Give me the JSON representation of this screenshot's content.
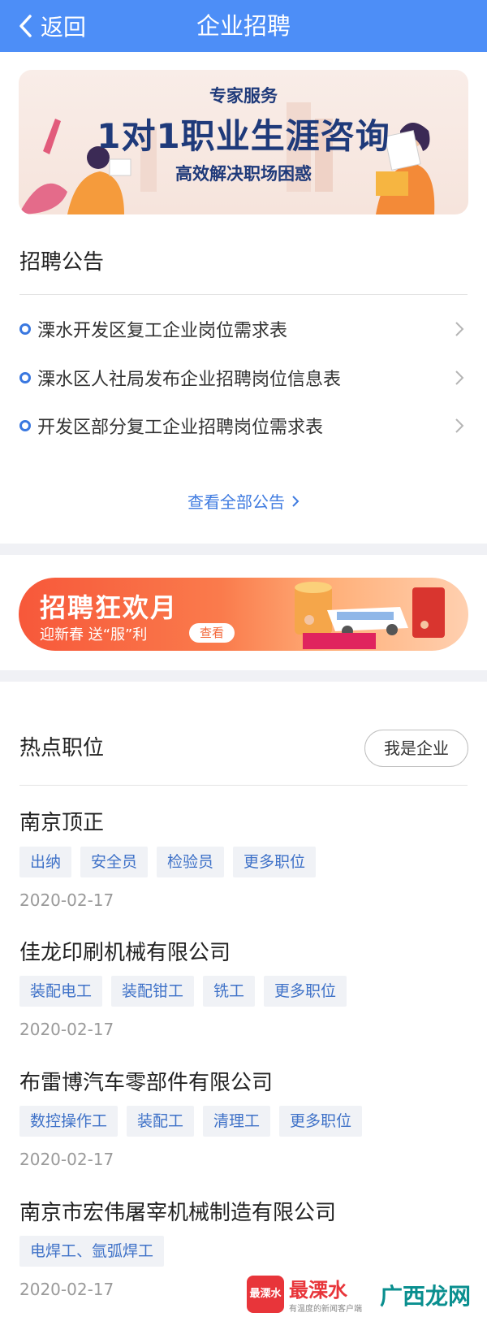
{
  "header": {
    "back_label": "返回",
    "title": "企业招聘"
  },
  "banner_career": {
    "subtitle": "专家服务",
    "headline": "1对1职业生涯咨询",
    "tagline": "高效解决职场困惑"
  },
  "notices": {
    "title": "招聘公告",
    "items": [
      {
        "label": "溧水开发区复工企业岗位需求表"
      },
      {
        "label": "溧水区人社局发布企业招聘岗位信息表"
      },
      {
        "label": "开发区部分复工企业招聘岗位需求表"
      }
    ],
    "view_all": "查看全部公告"
  },
  "banner_festival": {
    "title": "招聘狂欢月",
    "subtitle": "迎新春  送“服”利",
    "button": "查看"
  },
  "hot_jobs": {
    "title": "热点职位",
    "company_button": "我是企业",
    "companies": [
      {
        "name": "南京顶正",
        "tags": [
          "出纳",
          "安全员",
          "检验员",
          "更多职位"
        ],
        "date": "2020-02-17"
      },
      {
        "name": "佳龙印刷机械有限公司",
        "tags": [
          "装配电工",
          "装配钳工",
          "铣工",
          "更多职位"
        ],
        "date": "2020-02-17"
      },
      {
        "name": "布雷博汽车零部件有限公司",
        "tags": [
          "数控操作工",
          "装配工",
          "清理工",
          "更多职位"
        ],
        "date": "2020-02-17"
      },
      {
        "name": "南京市宏伟屠宰机械制造有限公司",
        "tags": [
          "电焊工、氩弧焊工"
        ],
        "date": "2020-02-17"
      }
    ]
  },
  "watermark": {
    "logo1": "最溧水",
    "text1": "最溧水",
    "small1": "有温度的新闻客户端",
    "text2": "广西龙网"
  },
  "colors": {
    "header_bg": "#4d8ef7",
    "accent_blue": "#3f7be0",
    "tag_bg": "#f0f2f6",
    "tag_text": "#3f72c8"
  }
}
